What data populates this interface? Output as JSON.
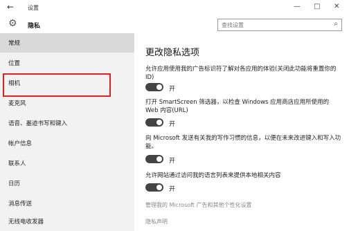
{
  "titlebar": {
    "back_icon": "arrow-left-icon",
    "app_title": "设置",
    "minimize": "—",
    "maximize": "□",
    "close": "✕"
  },
  "header": {
    "gear_icon": "gear-icon",
    "title": "隐私",
    "search_placeholder": "查找设置",
    "search_icon": "search-icon"
  },
  "sidebar": {
    "items": [
      {
        "label": "常规",
        "active": true
      },
      {
        "label": "位置"
      },
      {
        "label": "相机"
      },
      {
        "label": "麦克风"
      },
      {
        "label": "语音、墨迹书写和键入"
      },
      {
        "label": "帐户信息"
      },
      {
        "label": "联系人"
      },
      {
        "label": "日历"
      },
      {
        "label": "消息传送"
      },
      {
        "label": "无线电收发器"
      }
    ]
  },
  "main": {
    "title": "更改隐私选项",
    "options": [
      {
        "text": "允许应用使用我的广告标识符了解对各应用的体验(关闭此功能将重置你的 ID)",
        "state": "开"
      },
      {
        "text": "打开 SmartScreen 筛选器，以检查 Windows 应用商店应用所使用的 Web 内容(URL)",
        "state": "开"
      },
      {
        "text": "向 Microsoft 发送有关我的写作习惯的信息，以便在未来改进键入和写入功能。",
        "state": "开"
      },
      {
        "text": "允许网站通过访问我的语言列表来提供本地相关内容",
        "state": "开"
      }
    ],
    "links": {
      "ad_settings": "管理我的 Microsoft 广告和其他个性化设置",
      "privacy_statement": "隐私声明"
    }
  },
  "colors": {
    "highlight_border": "#e02020",
    "toggle_on": "#444444",
    "sidebar_bg": "#f2f2f2",
    "active_item_bg": "#d9d9d9"
  }
}
